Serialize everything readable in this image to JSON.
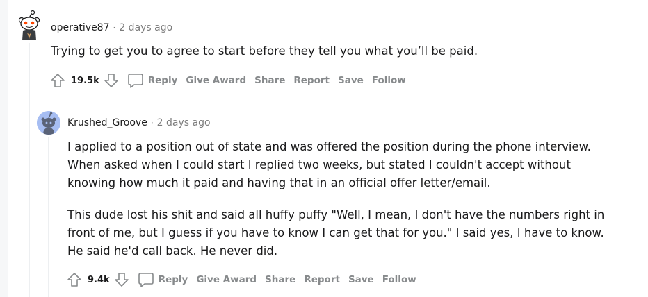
{
  "comments": [
    {
      "author": "operative87",
      "separator": "·",
      "time": "2 days ago",
      "paragraphs": [
        "Trying to get you to agree to start before they tell you what you’ll be paid."
      ],
      "votes": "19.5k",
      "actions": {
        "reply": "Reply",
        "give_award": "Give Award",
        "share": "Share",
        "report": "Report",
        "save": "Save",
        "follow": "Follow"
      }
    },
    {
      "author": "Krushed_Groove",
      "separator": "·",
      "time": "2 days ago",
      "paragraphs": [
        "I applied to a position out of state and was offered the position during the phone interview. When asked when I could start I replied two weeks, but stated I couldn't accept without knowing how much it paid and having that in an official offer letter/email.",
        "This dude lost his shit and said all huffy puffy \"Well, I mean, I don't have the numbers right in front of me, but I guess if you have to know I can get that for you.\" I said yes, I have to know. He said he'd call back. He never did."
      ],
      "votes": "9.4k",
      "actions": {
        "reply": "Reply",
        "give_award": "Give Award",
        "share": "Share",
        "report": "Report",
        "save": "Save",
        "follow": "Follow"
      }
    }
  ],
  "colors": {
    "meta_gray": "#7c7c7c",
    "action_gray": "#878a8c",
    "text": "#1a1a1b",
    "thread_line": "#edeff1"
  }
}
